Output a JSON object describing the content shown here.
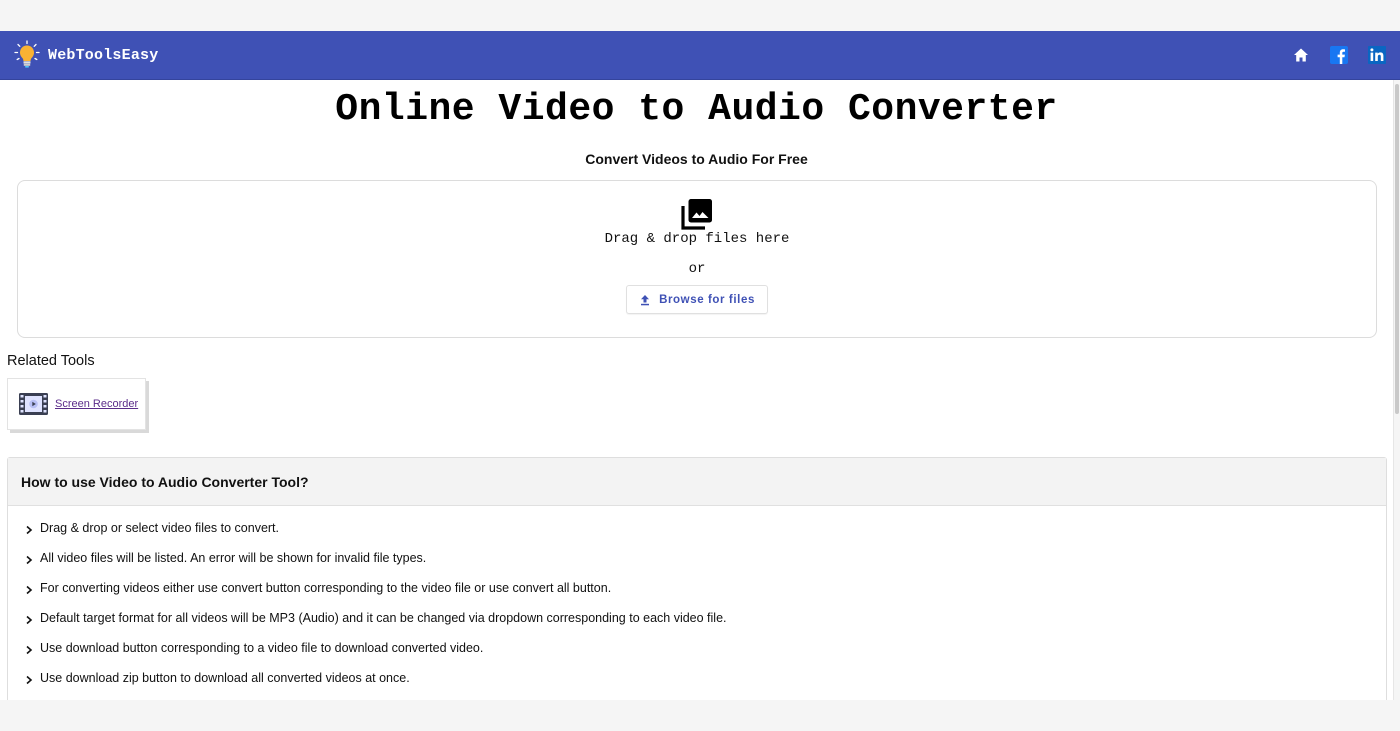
{
  "header": {
    "brand_name": "WebToolsEasy",
    "brand_icon": "lightbulb-icon",
    "nav_icons": [
      "home-icon",
      "facebook-icon",
      "linkedin-icon"
    ],
    "colors": {
      "navbar": "#3f51b5",
      "facebook": "#1877f2",
      "linkedin": "#0a66c2",
      "bulb": "#f9b233"
    }
  },
  "main": {
    "title": "Online Video to Audio Converter",
    "subtitle": "Convert Videos to Audio For Free",
    "dropzone": {
      "icon": "photo-library-icon",
      "text": "Drag & drop files here",
      "or_text": "or",
      "browse_label": "Browse for files",
      "browse_icon": "upload-icon"
    },
    "related_tools": {
      "title": "Related Tools",
      "items": [
        {
          "label": "Screen Recorder",
          "icon": "video-film-icon"
        }
      ]
    },
    "how_to": {
      "title": "How to use Video to Audio Converter Tool?",
      "steps": [
        "Drag & drop or select video files to convert.",
        "All video files will be listed. An error will be shown for invalid file types.",
        "For converting videos either use convert button corresponding to the video file or use convert all button.",
        "Default target format for all videos will be MP3 (Audio) and it can be changed via dropdown corresponding to each video file.",
        "Use download button corresponding to a video file to download converted video.",
        "Use download zip button to download all converted videos at once."
      ]
    }
  }
}
